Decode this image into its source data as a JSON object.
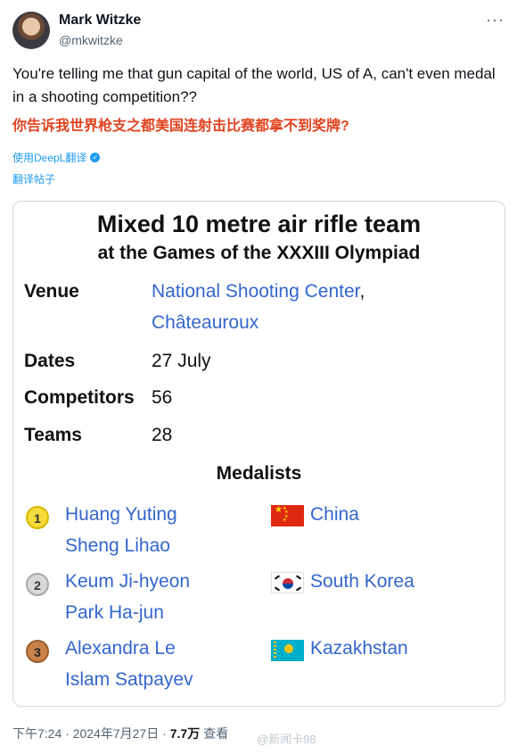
{
  "author": {
    "name": "Mark Witzke",
    "handle": "@mkwitzke"
  },
  "tweet": {
    "text": "You're telling me that gun capital of the world, US of A, can't even medal in a shooting competition??",
    "translation": "你告诉我世界枪支之都美国连射击比赛都拿不到奖牌?",
    "deepl_label": "使用DeepL翻译",
    "translate_label": "翻译帖子"
  },
  "card": {
    "title_line1": "Mixed 10 metre air rifle team",
    "title_line2": "at the Games of the XXXIII Olympiad",
    "venue_label": "Venue",
    "venue_link": "National Shooting Center",
    "venue_comma": ",",
    "venue_city": "Châteauroux",
    "dates_label": "Dates",
    "dates_value": "27 July",
    "competitors_label": "Competitors",
    "competitors_value": "56",
    "teams_label": "Teams",
    "teams_value": "28",
    "medalists_label": "Medalists",
    "medalists": [
      {
        "rank": "1",
        "athletes": [
          "Huang Yuting",
          "Sheng Lihao"
        ],
        "country": "China",
        "flag": "china-flag-icon"
      },
      {
        "rank": "2",
        "athletes": [
          "Keum Ji-hyeon",
          "Park Ha-jun"
        ],
        "country": "South Korea",
        "flag": "south-korea-flag-icon"
      },
      {
        "rank": "3",
        "athletes": [
          "Alexandra Le",
          "Islam Satpayev"
        ],
        "country": "Kazakhstan",
        "flag": "kazakhstan-flag-icon"
      }
    ]
  },
  "footer": {
    "timestamp": "下午7:24 · 2024年7月27日 ·",
    "views": "7.7万",
    "views_label": "查看",
    "watermark": "@新闻卡98"
  },
  "colors": {
    "link": "#3366cc",
    "accent": "#1d9bf0",
    "translation": "#e0431f"
  }
}
